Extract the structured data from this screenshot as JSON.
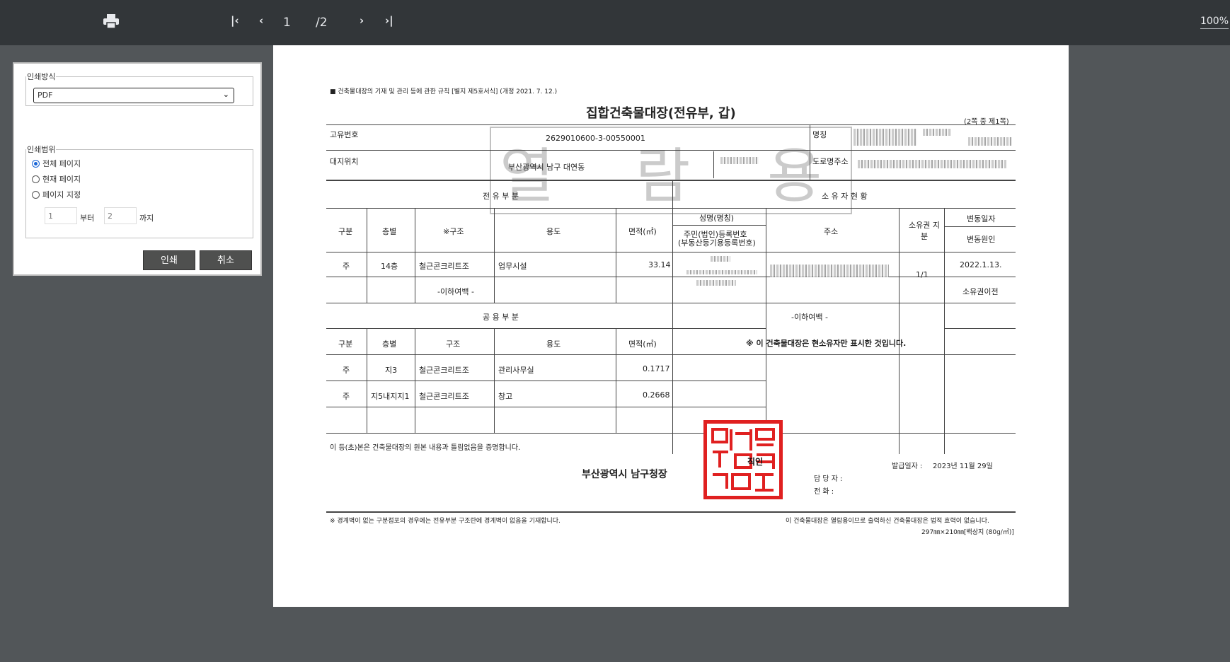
{
  "toolbar": {
    "page_current": "1",
    "page_total": "/2",
    "zoom": "100%",
    "icons": [
      "print-icon",
      "first-page-icon",
      "prev-page-icon",
      "next-page-icon",
      "last-page-icon"
    ]
  },
  "print_panel": {
    "method_legend": "인쇄방식",
    "method_value": "PDF",
    "range_legend": "인쇄범위",
    "options": [
      "전체 페이지",
      "현재 페이지",
      "페이지 지정"
    ],
    "selected_option": "전체 페이지",
    "from_value": "1",
    "from_unit": "부터",
    "to_value": "2",
    "to_unit": "까지",
    "print_label": "인쇄",
    "cancel_label": "취소"
  },
  "document": {
    "rule_note": "■ 건축물대장의 기재 및 관리 등에 관한 규칙 [별지 제5호서식] (개정 2021. 7. 12.)",
    "title": "집합건축물대장(전유부, 갑)",
    "page_info": "(2쪽 중 제1쪽)",
    "watermark": [
      "열",
      "람",
      "용"
    ],
    "unique_no_label": "고유번호",
    "unique_no": "2629010600-3-00550001",
    "name_label": "명칭",
    "site_label": "대지위치",
    "site_value": "부산광역시 남구 대연동",
    "road_label": "도로명주소",
    "exclusive_section": "전 유 부 분",
    "owner_section": "소 유 자 현 황",
    "h_gubun": "구분",
    "h_floor": "층별",
    "h_structure_star": "※구조",
    "h_structure": "구조",
    "h_use": "용도",
    "h_area": "면적(㎡)",
    "h_owner_name": "성명(명칭)",
    "h_owner_id": "주민(법인)등록번호",
    "h_owner_id2": "(부동산등기용등록번호)",
    "h_address": "주소",
    "h_share": "소유권 지분",
    "h_change_date": "변동일자",
    "h_change_reason": "변동원인",
    "exclusive_rows": [
      {
        "gubun": "주",
        "floor": "14층",
        "structure": "철근콘크리트조",
        "use": "업무시설",
        "area": "33.14"
      }
    ],
    "blank_mark": "-이하여백 -",
    "owner_share": "1/1",
    "owner_date": "2022.1.13.",
    "owner_reason": "소유권이전",
    "common_section": "공 용 부 분",
    "common_rows": [
      {
        "gubun": "주",
        "floor": "지3",
        "structure": "철근콘크리트조",
        "use": "관리사무실",
        "area": "0.1717"
      },
      {
        "gubun": "주",
        "floor": "지5내지지1",
        "structure": "철근콘크리트조",
        "use": "창고",
        "area": "0.2668"
      }
    ],
    "owner_blank": "-이하여백 -",
    "owner_note": "※ 이 건축물대장은 현소유자만 표시한 것입니다.",
    "certify": "이 등(초)본은 건축물대장의 원본 내용과 틀림없음을 증명합니다.",
    "issuer": "부산광역시 남구청장",
    "seal_label": "직인",
    "issue_date_label": "발급일자 :",
    "issue_date": "2023년 11월 29일",
    "staff_label": "담 당 자 :",
    "phone_label": "전    화 :",
    "footer_left": "※ 경계벽이 없는 구분점포의 경우에는 전유부분 구조란에 경계벽이 없음을 기재합니다.",
    "footer_right": "이 건축물대장은 열람용이므로 출력하신 건축물대장은 법적 효력이 없습니다.",
    "paper_size": "297㎜×210㎜[백상지 (80g/㎡)]"
  }
}
